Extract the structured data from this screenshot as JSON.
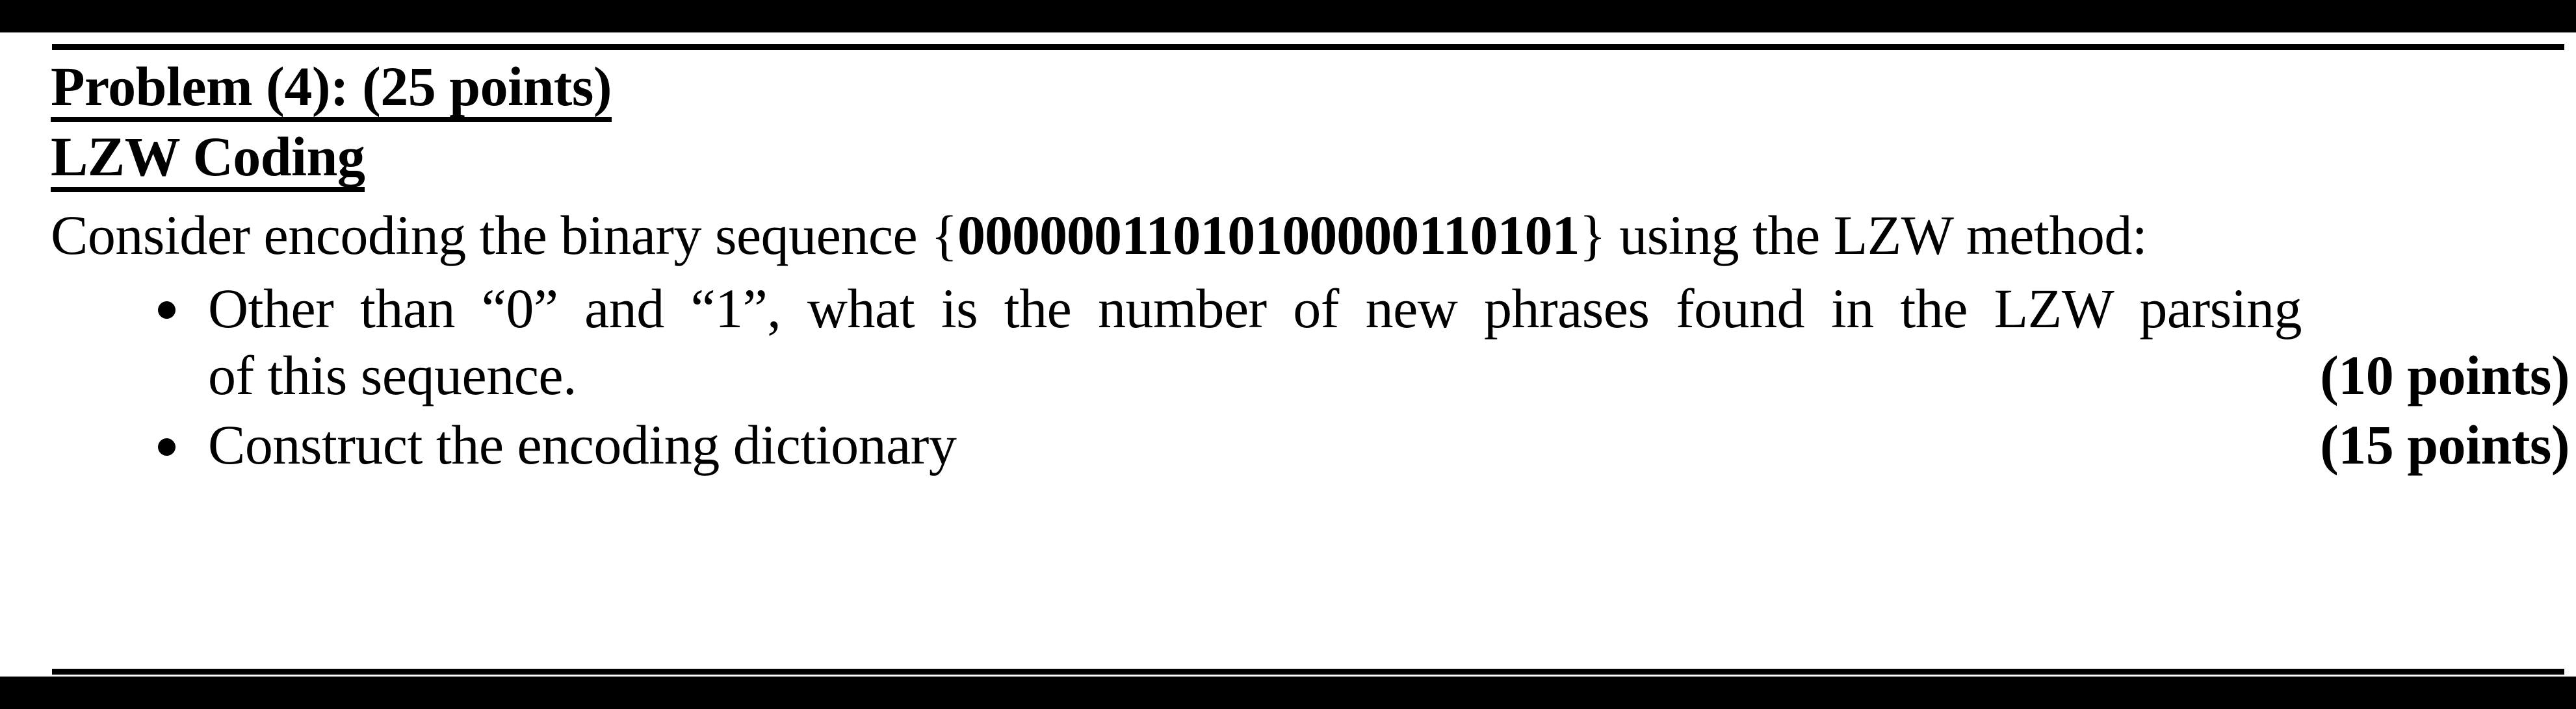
{
  "document": {
    "problem_heading": "Problem (4): (25 points)",
    "topic_heading": "LZW Coding",
    "intro": {
      "before_sequence": "Consider encoding the binary sequence {",
      "sequence": "00000011010100000110101",
      "after_sequence": "} using the LZW method:"
    },
    "bullets": [
      {
        "line1": "Other than “0” and “1”, what is the number of new phrases found in the LZW parsing",
        "line2": "of this sequence.",
        "points": "(10 points)"
      },
      {
        "line1": "Construct the encoding dictionary",
        "line2": "",
        "points": "(15 points)"
      }
    ]
  }
}
